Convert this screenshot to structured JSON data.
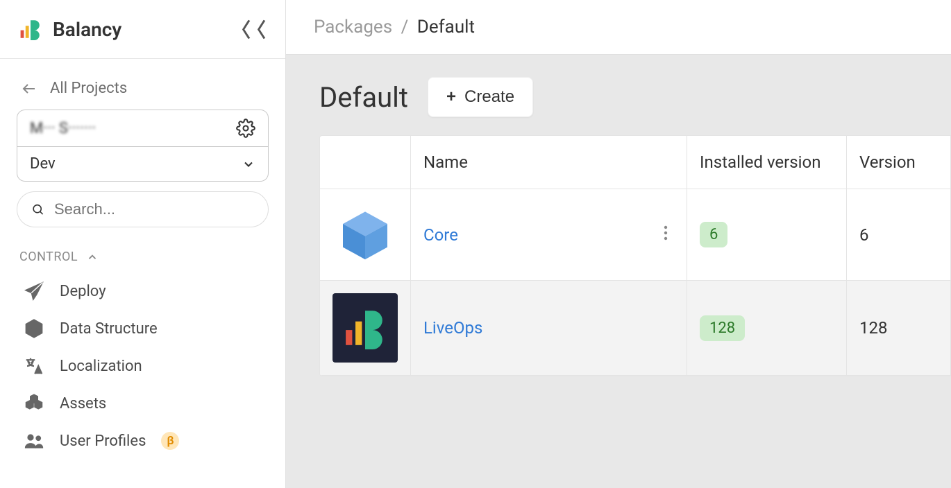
{
  "brand": {
    "name": "Balancy"
  },
  "sidebar": {
    "all_projects": "All Projects",
    "project_name": "M··· S·······",
    "env": "Dev",
    "search_placeholder": "Search...",
    "section_control": "CONTROL",
    "items": [
      {
        "label": "Deploy"
      },
      {
        "label": "Data Structure"
      },
      {
        "label": "Localization"
      },
      {
        "label": "Assets"
      },
      {
        "label": "User Profiles",
        "beta": "β"
      }
    ]
  },
  "breadcrumb": {
    "root": "Packages",
    "current": "Default"
  },
  "page": {
    "title": "Default",
    "create_label": "Create"
  },
  "table": {
    "headers": {
      "name": "Name",
      "installed": "Installed version",
      "version": "Version"
    },
    "rows": [
      {
        "name": "Core",
        "installed": "6",
        "version": "6",
        "icon": "cube"
      },
      {
        "name": "LiveOps",
        "installed": "128",
        "version": "128",
        "icon": "liveops"
      }
    ]
  }
}
